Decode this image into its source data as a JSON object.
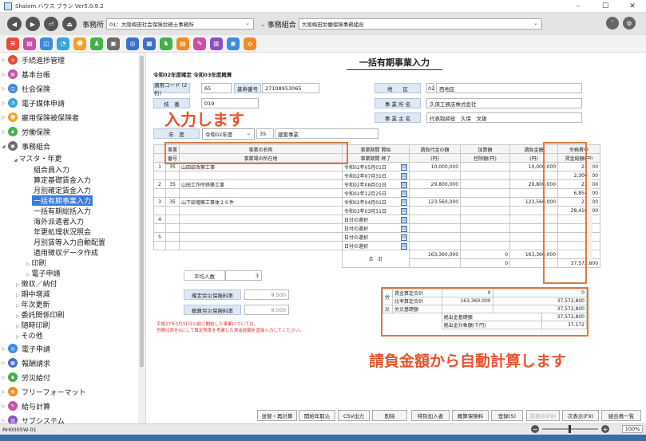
{
  "window": {
    "title": "Shalom ハウス ブラン Ver5.0.9.2",
    "min": "–",
    "max": "☐",
    "close": "✕"
  },
  "toolbar": {
    "office_label": "事務所",
    "office_value": "01：大阪梅田社会保険労務士事務所",
    "union_label": "事務組合",
    "union_value": "大阪梅田労働保険事務組合",
    "nav_buttons": [
      "◀",
      "▶",
      "⏎",
      "⏏"
    ]
  },
  "sidebar": {
    "items": [
      {
        "label": "手続進捗管理",
        "color": "#e84b3a"
      },
      {
        "label": "基本台帳",
        "color": "#c84fa9"
      },
      {
        "label": "社会保険",
        "color": "#3c8be0"
      },
      {
        "label": "電子媒体申請",
        "color": "#37a6d9"
      },
      {
        "label": "雇用保険被保険者",
        "color": "#f0a322"
      },
      {
        "label": "労働保険",
        "color": "#43b14a"
      },
      {
        "label": "事務組合",
        "color": "#6b6b6b"
      }
    ],
    "sub": {
      "master": "マスタ・年更",
      "entries": [
        "組合員入力",
        "算定基礎賃金入力",
        "月別確定賃金入力",
        "一括有期事業入力",
        "一括有期総括入力",
        "海外派遣者入力",
        "年更処理状況照会",
        "月別賃等入力自動配置",
        "適用徴収データ作成"
      ],
      "print": "印刷",
      "e_apply": "電子申請"
    },
    "lower": [
      "徴収／納付",
      "期中増減",
      "年次更新",
      "委託関係印刷",
      "随時印刷",
      "その他"
    ],
    "bottom_items": [
      {
        "label": "電子申請",
        "color": "#3c8be0"
      },
      {
        "label": "報酬請求",
        "color": "#3c6fd0"
      },
      {
        "label": "労災給付",
        "color": "#43b14a"
      },
      {
        "label": "フリーフォーマット",
        "color": "#f08a22"
      },
      {
        "label": "給与計算",
        "color": "#c84fa9"
      },
      {
        "label": "サブシステム",
        "color": "#8a4fc8"
      }
    ]
  },
  "form": {
    "title": "一括有期事業入力",
    "meta1": "令和02年度確定",
    "meta2": "令和03年度概算",
    "app_code_label": "適用コード (2桁)",
    "app_code": "65",
    "base_no_label": "基幹番号",
    "base_no": "27108953065",
    "branch_label": "枝　番",
    "branch": "019",
    "year_label": "年　度",
    "year_value": "令和02年度",
    "year_code": "35",
    "year_name": "建築事業",
    "area_label": "地　　区",
    "area_code": "02",
    "area_name": "西地区",
    "company_label": "事 業 所 名",
    "company": "久保工務店株式会社",
    "owner_label": "事 業 主 名",
    "owner": "代表取締役　久保　文雄",
    "annot1": "入力します",
    "annot2": "請負金額から自動計算します"
  },
  "grid": {
    "headers_top": [
      "事業",
      "事業の名称",
      "事業期間 開始",
      "請負代金の額",
      "加算額",
      "請負金額",
      "労務費率"
    ],
    "headers_bottom": [
      "番号",
      "事業場の所在地",
      "事業期間 終了",
      "(円)",
      "控除額(円)",
      "(円)",
      "賃金総額(円)"
    ],
    "rows": [
      {
        "no": "1",
        "code": "35",
        "name": "山田邸改築工事",
        "start": "令和02年05月01日",
        "end": "令和02年07月31日",
        "contract": "10,000,000",
        "add": "",
        "amount": "10,000,000",
        "rate": "23.000",
        "wage": "2,300,000"
      },
      {
        "no": "2",
        "code": "35",
        "name": "山田工作所移築工事",
        "start": "令和02年08月01日",
        "end": "令和02年12月25日",
        "contract": "29,800,000",
        "add": "",
        "amount": "29,800,000",
        "rate": "23.000",
        "wage": "6,854,000"
      },
      {
        "no": "3",
        "code": "35",
        "name": "山下邸増築工事体２６件",
        "start": "令和02年04月01日",
        "end": "令和03年03月31日",
        "contract": "123,560,000",
        "add": "",
        "amount": "123,560,000",
        "rate": "23.000",
        "wage": "28,418,800"
      },
      {
        "no": "4",
        "code": "",
        "name": "",
        "start": "日付の選択",
        "end": "日付の選択",
        "contract": "",
        "add": "",
        "amount": "",
        "rate": "",
        "wage": ""
      },
      {
        "no": "5",
        "code": "",
        "name": "",
        "start": "日付の選択",
        "end": "日付の選択",
        "contract": "",
        "add": "",
        "amount": "",
        "rate": "",
        "wage": ""
      }
    ],
    "total_label": "合　計",
    "total_contract": "163,360,000",
    "total_add": "0",
    "total_amount": "163,360,000",
    "total_zero": "0",
    "total_wage": "37,572,800",
    "avg_label": "平均人数",
    "avg_value": "3"
  },
  "rates": {
    "fixed_label": "確定労災保険料率",
    "fixed_value": "9.500",
    "estimate_label": "概算労災保険料率",
    "estimate_value": "9.500"
  },
  "summary": {
    "rou": "労",
    "sai": "災",
    "r1_label": "賃金算定合計",
    "r1_a": "0",
    "r1_b": "0",
    "r2_label": "比率算定合計",
    "r2_a": "163,360,000",
    "r2_b": "37,572,800",
    "r3_label": "労災基礎額",
    "r3_b": "37,572,800",
    "r4_label": "拠出金基礎額",
    "r4_b": "37,572,800",
    "r5_label": "拠出金対象額(千円)",
    "r5_b": "37,572"
  },
  "note": {
    "line1": "平成27年3月31日以前に開始した事業については、",
    "line2": "労務比率を0にして算定税率を考慮した賃金総額を直接入力してください。"
  },
  "buttons": [
    "並替・再計算",
    "開始年取込",
    "CSV出力",
    "削除",
    "特別加入者",
    "概算保険料",
    "登録(S)",
    "前表示(F8)",
    "次表示(F9)",
    "組合員一覧"
  ],
  "status": {
    "code": "RH0005W-01",
    "zoom": "100%",
    "minus": "−",
    "plus": "+"
  }
}
